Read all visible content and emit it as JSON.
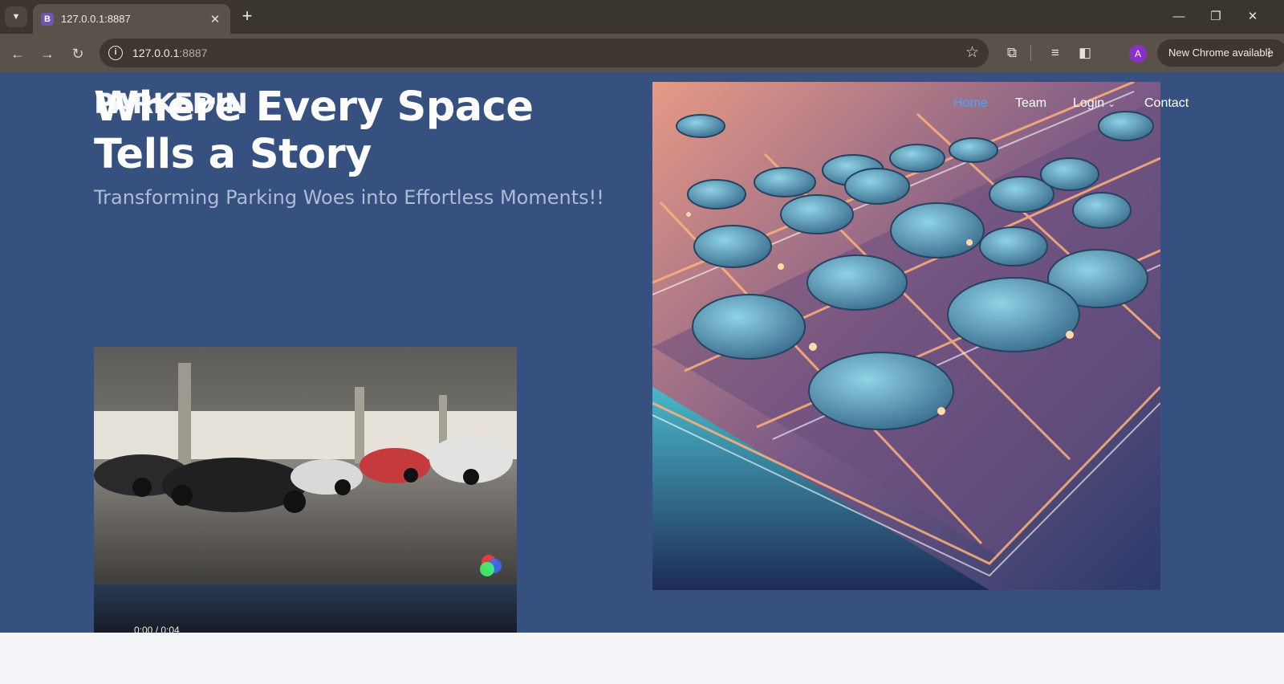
{
  "browser": {
    "tab_title": "127.0.0.1:8887",
    "favicon_letter": "B",
    "url_host": "127.0.0.1",
    "url_port": ":8887",
    "avatar_letter": "A",
    "update_label": "New Chrome available",
    "icons": {
      "tab_list": "chevron-down-icon",
      "tab_close": "close-icon",
      "new_tab": "plus-icon",
      "back": "arrow-left-icon",
      "forward": "arrow-right-icon",
      "reload": "reload-icon",
      "site_info": "info-icon",
      "bookmark": "star-icon",
      "extensions": "puzzle-icon",
      "media": "media-queue-icon",
      "side_panel": "side-panel-icon",
      "menu": "more-vertical-icon"
    }
  },
  "site": {
    "brand": "PARKEDIN",
    "headline": "Where Every Space Tells a Story",
    "subhead": "Transforming Parking Woes into Effortless Moments!!",
    "nav": {
      "home": "Home",
      "team": "Team",
      "login": "Login",
      "contact": "Contact"
    },
    "video_time": "0:00 / 0:04",
    "colors": {
      "page_bg": "#36517f",
      "nav_active": "#4ba3ff",
      "subhead": "#aebbd3"
    }
  }
}
